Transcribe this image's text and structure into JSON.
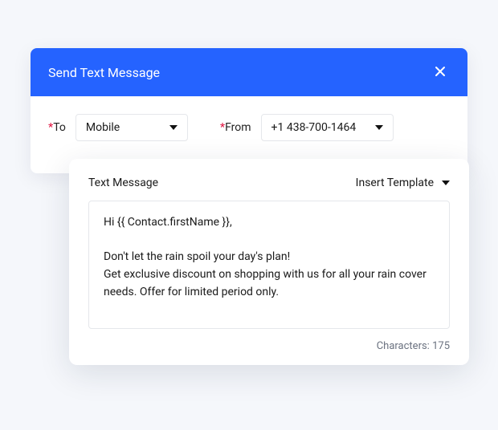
{
  "dialog": {
    "title": "Send Text Message",
    "close_icon": "close"
  },
  "fields": {
    "to": {
      "label": "To",
      "required_marker": "*",
      "value": "Mobile"
    },
    "from": {
      "label": "From",
      "required_marker": "*",
      "value": "+1 438-700-1464"
    }
  },
  "message": {
    "section_label": "Text Message",
    "template_button": "Insert Template",
    "body": "Hi {{ Contact.firstName }},\n\nDon't let the rain spoil your day's plan!\nGet exclusive discount on shopping with us for all your rain cover needs. Offer for limited period only.",
    "character_label": "Characters:",
    "character_count": "175"
  },
  "colors": {
    "accent": "#2563ff",
    "required": "#e11d48"
  }
}
